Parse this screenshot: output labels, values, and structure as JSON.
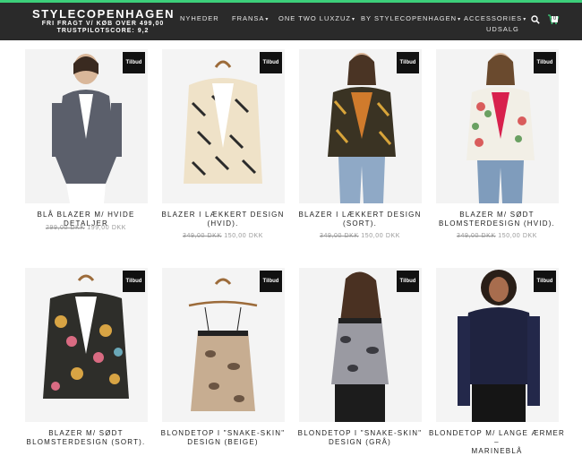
{
  "header": {
    "brand": "STYLECOPENHAGEN",
    "tagline_1": "FRI FRAGT V/ KØB OVER 499,00",
    "tagline_2": "TRUSTPILOTSCORE: 9,2",
    "nav": [
      {
        "label": "NYHEDER",
        "has_caret": false
      },
      {
        "label": "FRANSA",
        "has_caret": true
      },
      {
        "label": "ONE TWO LUXZUZ",
        "has_caret": true
      },
      {
        "label": "BY STYLECOPENHAGEN",
        "has_caret": true
      },
      {
        "label": "ACCESSORIES",
        "has_caret": true
      },
      {
        "label": "UDSALG",
        "has_caret": false
      }
    ],
    "cart_count": "0",
    "search_icon": "search-icon",
    "cart_icon": "cart-icon",
    "accent_color": "#3ccf7a"
  },
  "products": [
    {
      "title_1": "BLÅ BLAZER M/ HVIDE DETALJER",
      "title_2": "",
      "old_price": "299,00 DKK",
      "price": "199,00 DKK",
      "badge": "Tilbud"
    },
    {
      "title_1": "BLAZER I LÆKKERT DESIGN",
      "title_2": "(HVID).",
      "old_price": "349,00 DKK",
      "price": "150,00 DKK",
      "badge": "Tilbud"
    },
    {
      "title_1": "BLAZER I LÆKKERT DESIGN",
      "title_2": "(SORT).",
      "old_price": "349,00 DKK",
      "price": "150,00 DKK",
      "badge": "Tilbud"
    },
    {
      "title_1": "BLAZER M/ SØDT",
      "title_2": "BLOMSTERDESIGN (HVID).",
      "old_price": "349,00 DKK",
      "price": "150,00 DKK",
      "badge": "Tilbud"
    },
    {
      "title_1": "BLAZER M/ SØDT",
      "title_2": "BLOMSTERDESIGN (SORT).",
      "old_price": "",
      "price": "",
      "badge": "Tilbud"
    },
    {
      "title_1": "BLONDETOP I \"SNAKE-SKIN\"",
      "title_2": "DESIGN (BEIGE)",
      "old_price": "",
      "price": "",
      "badge": "Tilbud"
    },
    {
      "title_1": "BLONDETOP I \"SNAKE-SKIN\"",
      "title_2": "DESIGN (GRÅ)",
      "old_price": "",
      "price": "",
      "badge": "Tilbud"
    },
    {
      "title_1": "BLONDETOP M/ LANGE ÆRMER –",
      "title_2": "MARINEBLÅ",
      "old_price": "",
      "price": "",
      "badge": "Tilbud"
    }
  ]
}
